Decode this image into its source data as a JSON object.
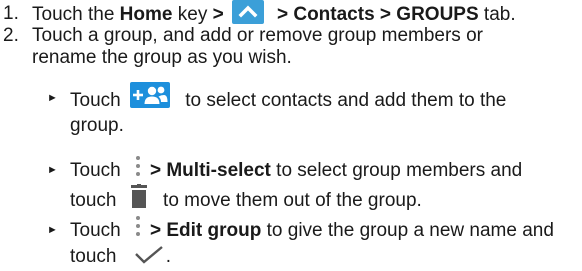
{
  "steps": [
    {
      "number": "1.",
      "parts": [
        "Touch the ",
        "Home",
        " key ",
        ">",
        " > Contacts > GROUPS",
        " tab."
      ]
    },
    {
      "number": "2.",
      "line1": "Touch a group, and add or remove group members or",
      "line2": "rename the group as you wish."
    }
  ],
  "bullets": [
    {
      "symbol": "►",
      "pre": "Touch ",
      "post_line1": " to select contacts and add them to the",
      "line2": "group."
    },
    {
      "symbol": "►",
      "pre": "Touch ",
      "bold": "> Multi-select",
      "post_line1": " to select group members and",
      "line2_pre": "touch ",
      "line2_post": " to move them out of the group."
    },
    {
      "symbol": "►",
      "pre": "Touch ",
      "bold": "> Edit group",
      "post_line1": " to give the group a new name and",
      "line2_pre": "touch ",
      "line2_post": "."
    }
  ],
  "icons": {
    "home": "home-key-icon",
    "add_contacts": "add-group-members-icon",
    "menu": "more-options-icon",
    "trash": "delete-icon",
    "check": "checkmark-icon"
  },
  "colors": {
    "home_icon": "#3b9fd8",
    "add_icon": "#1d8fdc",
    "text": "#1a1a1a"
  }
}
